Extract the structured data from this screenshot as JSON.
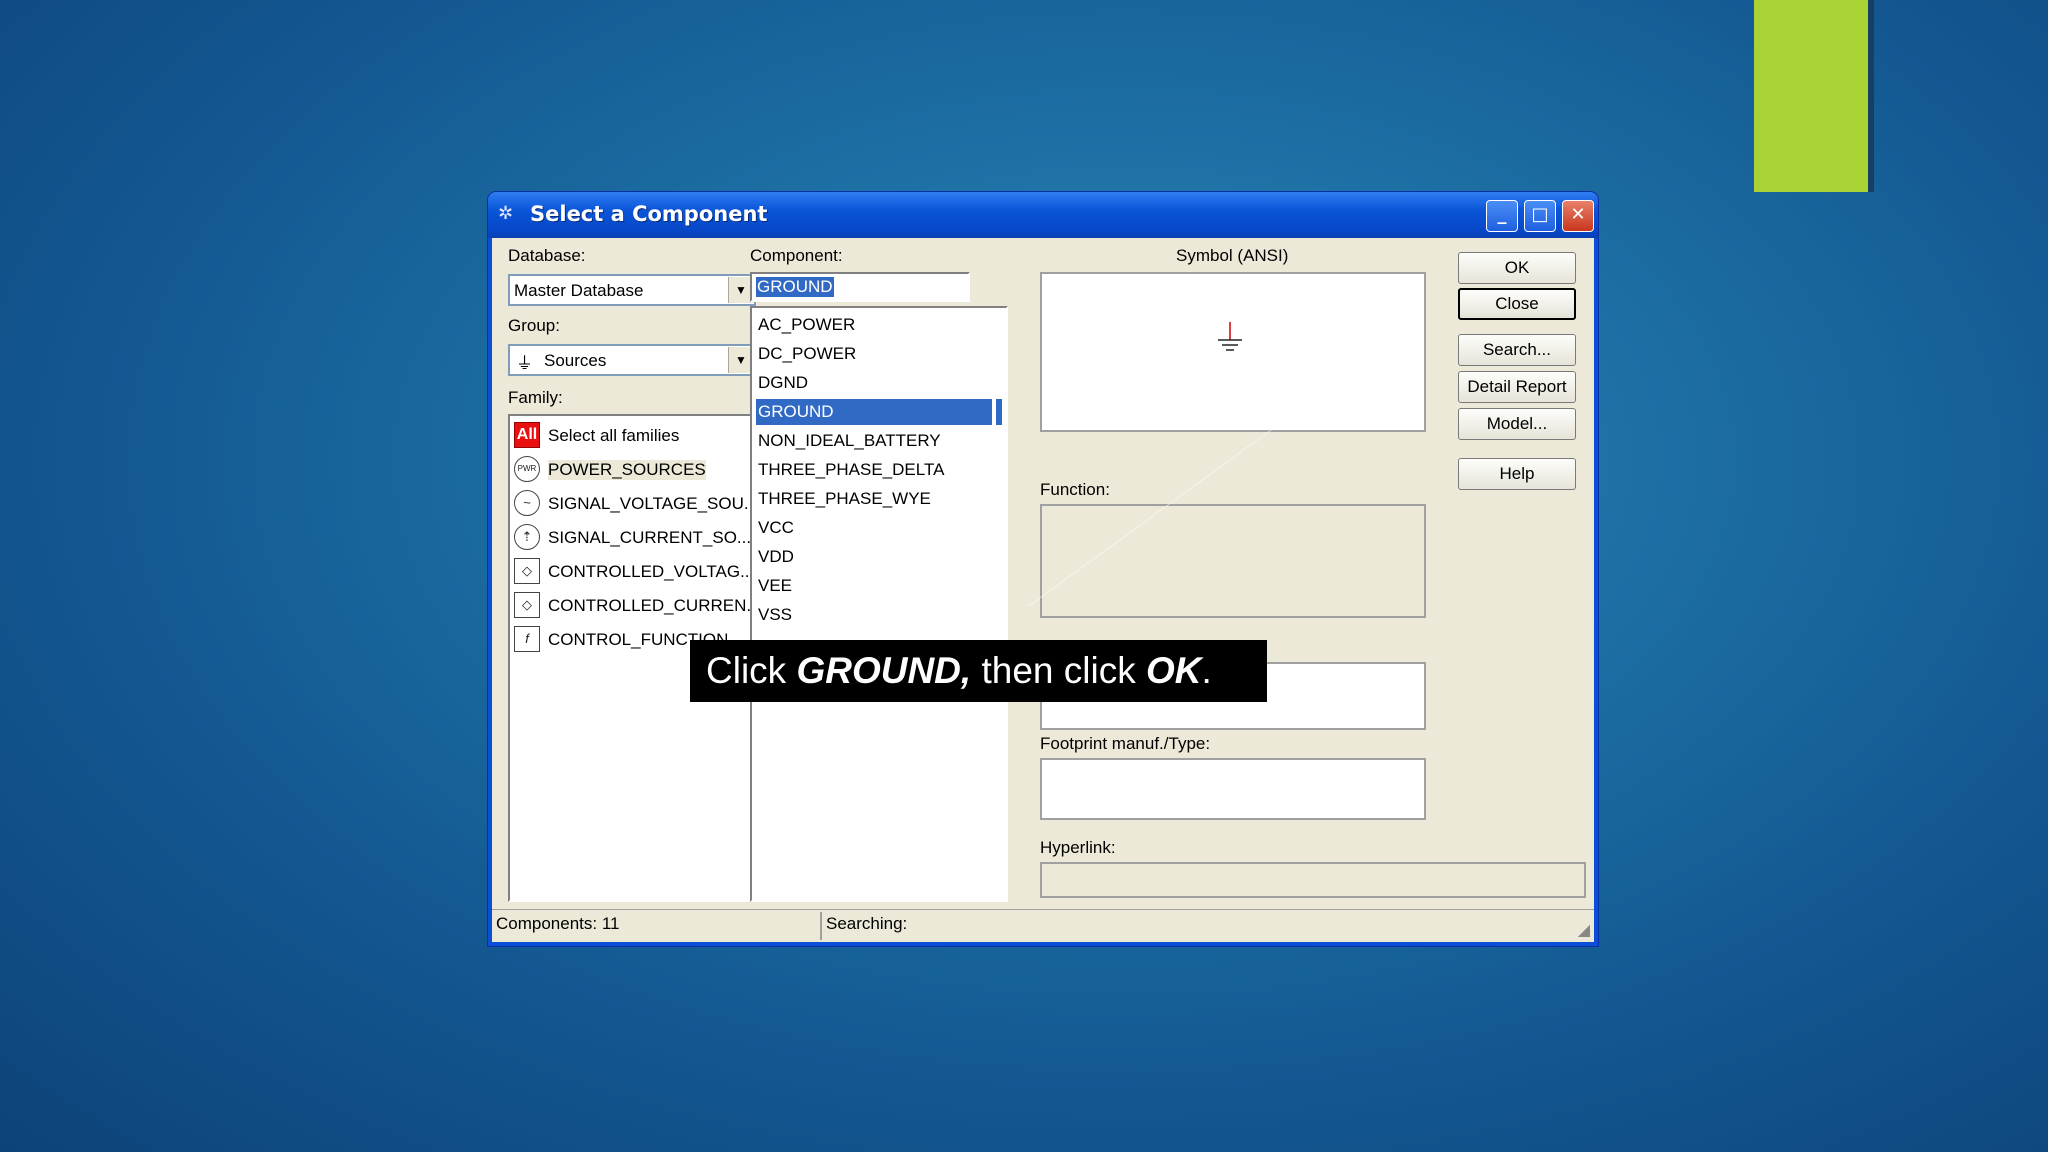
{
  "window": {
    "title": "Select a Component"
  },
  "database": {
    "label": "Database:",
    "value": "Master Database"
  },
  "group": {
    "label": "Group:",
    "value": "Sources"
  },
  "family": {
    "label": "Family:",
    "items": [
      {
        "label": "Select all families",
        "icon": "all"
      },
      {
        "label": "POWER_SOURCES",
        "icon": "PWR"
      },
      {
        "label": "SIGNAL_VOLTAGE_SOU...",
        "icon": "~"
      },
      {
        "label": "SIGNAL_CURRENT_SO...",
        "icon": "~"
      },
      {
        "label": "CONTROLLED_VOLTAG...",
        "icon": "◇"
      },
      {
        "label": "CONTROLLED_CURREN...",
        "icon": "◇"
      },
      {
        "label": "CONTROL_FUNCTION...",
        "icon": "f"
      }
    ],
    "all_icon_text": "All"
  },
  "component": {
    "label": "Component:",
    "input_value": "GROUND",
    "items": [
      "AC_POWER",
      "DC_POWER",
      "DGND",
      "GROUND",
      "NON_IDEAL_BATTERY",
      "THREE_PHASE_DELTA",
      "THREE_PHASE_WYE",
      "VCC",
      "VDD",
      "VEE",
      "VSS"
    ],
    "selected": "GROUND"
  },
  "symbol": {
    "label": "Symbol (ANSI)"
  },
  "function": {
    "label": "Function:"
  },
  "footprint": {
    "label": "Footprint manuf./Type:"
  },
  "hyperlink": {
    "label": "Hyperlink:"
  },
  "buttons": {
    "ok": "OK",
    "close": "Close",
    "search": "Search...",
    "detail_report": "Detail Report",
    "model": "Model...",
    "help": "Help"
  },
  "status": {
    "components": "Components: 11",
    "searching": "Searching:"
  },
  "caption": {
    "pre": "Click ",
    "b1": "GROUND,",
    "mid": " then click ",
    "b2": "OK",
    "post": "."
  },
  "colors": {
    "accent": "#a9d234",
    "selection": "#316ac5",
    "titlebar": "#0a55d8"
  }
}
